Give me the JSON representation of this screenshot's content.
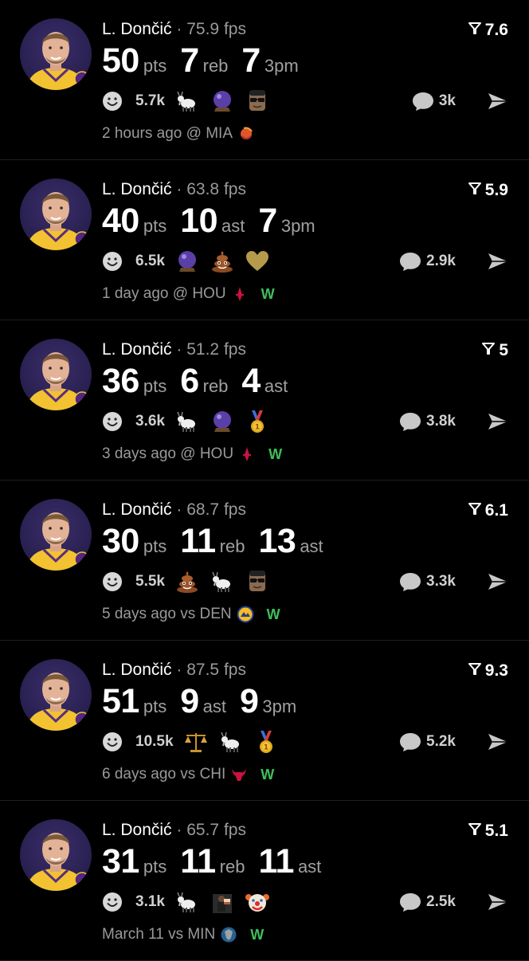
{
  "colors": {
    "background": "#000000",
    "muted_text": "#9a9a9a",
    "win_green": "#3fbf5a",
    "card_divider": "#1f1f1f"
  },
  "posts": [
    {
      "name": "L. Dončić",
      "separator": "·",
      "fps": "75.9 fps",
      "score": "7.6",
      "stats": [
        {
          "value": "50",
          "unit": "pts"
        },
        {
          "value": "7",
          "unit": "reb"
        },
        {
          "value": "7",
          "unit": "3pm"
        }
      ],
      "reaction_count": "5.7k",
      "emojis": [
        "goat-emoji",
        "crystal-ball-emoji",
        "sunglasses-person-emoji"
      ],
      "comment_count": "3k",
      "time": "2 hours ago",
      "venue_prefix": "@",
      "opponent": "MIA",
      "opponent_logo": "heat-logo-icon",
      "result": ""
    },
    {
      "name": "L. Dončić",
      "separator": "·",
      "fps": "63.8 fps",
      "score": "5.9",
      "stats": [
        {
          "value": "40",
          "unit": "pts"
        },
        {
          "value": "10",
          "unit": "ast"
        },
        {
          "value": "7",
          "unit": "3pm"
        }
      ],
      "reaction_count": "6.5k",
      "emojis": [
        "crystal-ball-emoji",
        "poop-emoji",
        "gold-heart-emoji"
      ],
      "comment_count": "2.9k",
      "time": "1 day ago",
      "venue_prefix": "@",
      "opponent": "HOU",
      "opponent_logo": "rockets-logo-icon",
      "result": "W"
    },
    {
      "name": "L. Dončić",
      "separator": "·",
      "fps": "51.2 fps",
      "score": "5",
      "stats": [
        {
          "value": "36",
          "unit": "pts"
        },
        {
          "value": "6",
          "unit": "reb"
        },
        {
          "value": "4",
          "unit": "ast"
        }
      ],
      "reaction_count": "3.6k",
      "emojis": [
        "goat-emoji",
        "crystal-ball-emoji",
        "gold-medal-emoji"
      ],
      "comment_count": "3.8k",
      "time": "3 days ago",
      "venue_prefix": "@",
      "opponent": "HOU",
      "opponent_logo": "rockets-logo-icon",
      "result": "W"
    },
    {
      "name": "L. Dončić",
      "separator": "·",
      "fps": "68.7 fps",
      "score": "6.1",
      "stats": [
        {
          "value": "30",
          "unit": "pts"
        },
        {
          "value": "11",
          "unit": "reb"
        },
        {
          "value": "13",
          "unit": "ast"
        }
      ],
      "reaction_count": "5.5k",
      "emojis": [
        "poop-emoji",
        "goat-emoji",
        "sunglasses-person-emoji"
      ],
      "comment_count": "3.3k",
      "time": "5 days ago",
      "venue_prefix": "vs",
      "opponent": "DEN",
      "opponent_logo": "nuggets-logo-icon",
      "result": "W"
    },
    {
      "name": "L. Dončić",
      "separator": "·",
      "fps": "87.5 fps",
      "score": "9.3",
      "stats": [
        {
          "value": "51",
          "unit": "pts"
        },
        {
          "value": "9",
          "unit": "ast"
        },
        {
          "value": "9",
          "unit": "3pm"
        }
      ],
      "reaction_count": "10.5k",
      "emojis": [
        "scales-emoji",
        "goat-emoji",
        "gold-medal-emoji"
      ],
      "comment_count": "5.2k",
      "time": "6 days ago",
      "venue_prefix": "vs",
      "opponent": "CHI",
      "opponent_logo": "bulls-logo-icon",
      "result": "W"
    },
    {
      "name": "L. Dončić",
      "separator": "·",
      "fps": "65.7 fps",
      "score": "5.1",
      "stats": [
        {
          "value": "31",
          "unit": "pts"
        },
        {
          "value": "11",
          "unit": "reb"
        },
        {
          "value": "11",
          "unit": "ast"
        }
      ],
      "reaction_count": "3.1k",
      "emojis": [
        "goat-emoji",
        "person-with-cake-emoji",
        "clown-emoji"
      ],
      "comment_count": "2.5k",
      "time": "March 11",
      "venue_prefix": "vs",
      "opponent": "MIN",
      "opponent_logo": "timberwolves-logo-icon",
      "result": "W"
    }
  ]
}
